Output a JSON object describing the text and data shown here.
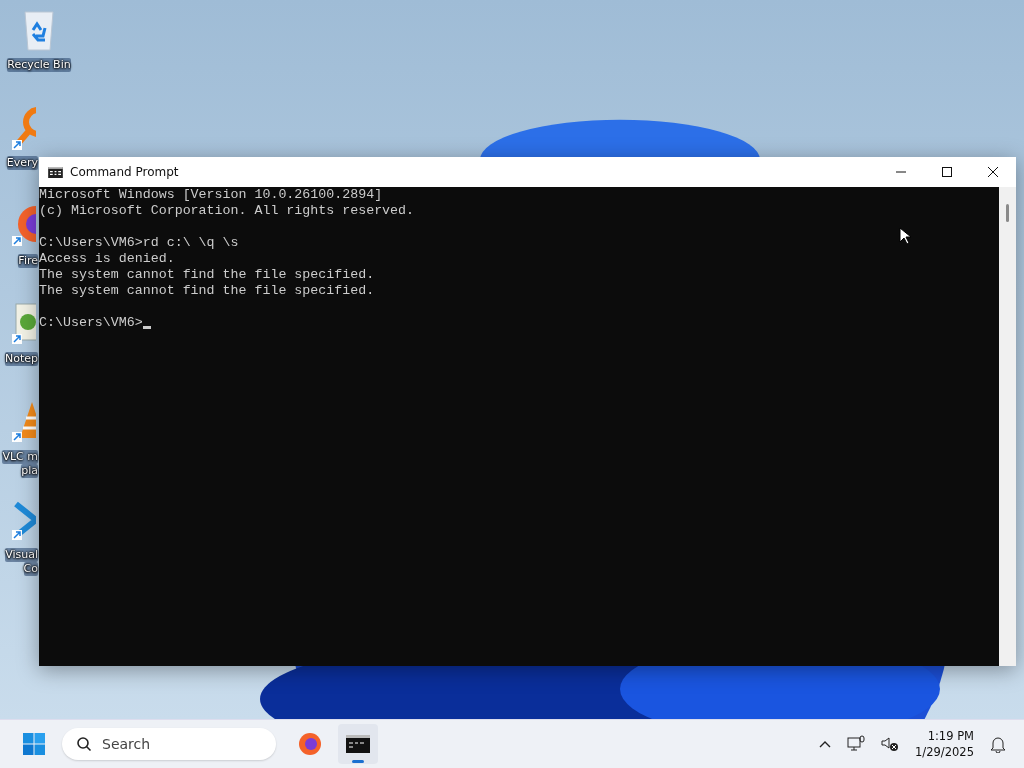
{
  "desktop_icons": [
    {
      "kind": "recycle",
      "lines": [
        "Recycle Bin"
      ]
    },
    {
      "kind": "magnifier",
      "lines": [
        "Every"
      ]
    },
    {
      "kind": "browser",
      "lines": [
        "Fire"
      ]
    },
    {
      "kind": "notepad",
      "lines": [
        "Notep"
      ]
    },
    {
      "kind": "cone",
      "lines": [
        "VLC m",
        "pla"
      ]
    },
    {
      "kind": "code",
      "lines": [
        "Visual",
        "Co"
      ]
    }
  ],
  "window": {
    "title": "Command Prompt",
    "console_blocks": [
      [
        "Microsoft Windows [Version 10.0.26100.2894]",
        "(c) Microsoft Corporation. All rights reserved."
      ],
      [
        "C:\\Users\\VM6>rd c:\\ \\q \\s",
        "Access is denied.",
        "The system cannot find the file specified.",
        "The system cannot find the file specified."
      ],
      [
        "C:\\Users\\VM6>"
      ]
    ],
    "caret": true
  },
  "taskbar": {
    "search": {
      "placeholder": "Search"
    },
    "apps": [
      {
        "kind": "browser",
        "active": false
      },
      {
        "kind": "terminal",
        "active": true
      }
    ],
    "clock": {
      "time": "1:19 PM",
      "date": "1/29/2025"
    }
  }
}
